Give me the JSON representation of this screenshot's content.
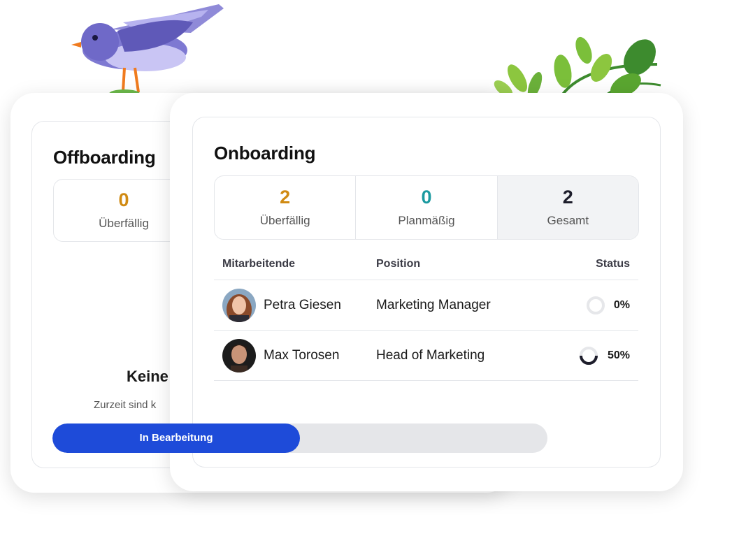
{
  "offboarding": {
    "title": "Offboarding",
    "stats": [
      {
        "value": "0",
        "label": "Überfällig"
      }
    ],
    "empty_title": "Keine",
    "empty_text": "Zurzeit sind k"
  },
  "onboarding": {
    "title": "Onboarding",
    "stats": [
      {
        "value": "2",
        "label": "Überfällig",
        "color": "#d08a12"
      },
      {
        "value": "0",
        "label": "Planmäßig",
        "color": "#1b9aa0"
      },
      {
        "value": "2",
        "label": "Gesamt",
        "color": "#1d1d2b"
      }
    ],
    "columns": {
      "employee": "Mitarbeitende",
      "position": "Position",
      "status": "Status"
    },
    "rows": [
      {
        "name": "Petra Giesen",
        "position": "Marketing Manager",
        "status": "0%",
        "progress": 0,
        "avatar": "avatar-woman"
      },
      {
        "name": "Max Torosen",
        "position": "Head of Marketing",
        "status": "50%",
        "progress": 0.5,
        "avatar": "avatar-man"
      }
    ]
  },
  "progress_bar": {
    "label": "In Bearbeitung",
    "fraction": 0.5,
    "fill_color": "#1e4bd9"
  },
  "decorations": {
    "bird": "bird-illustration",
    "plant": "plant-leaves-illustration"
  }
}
